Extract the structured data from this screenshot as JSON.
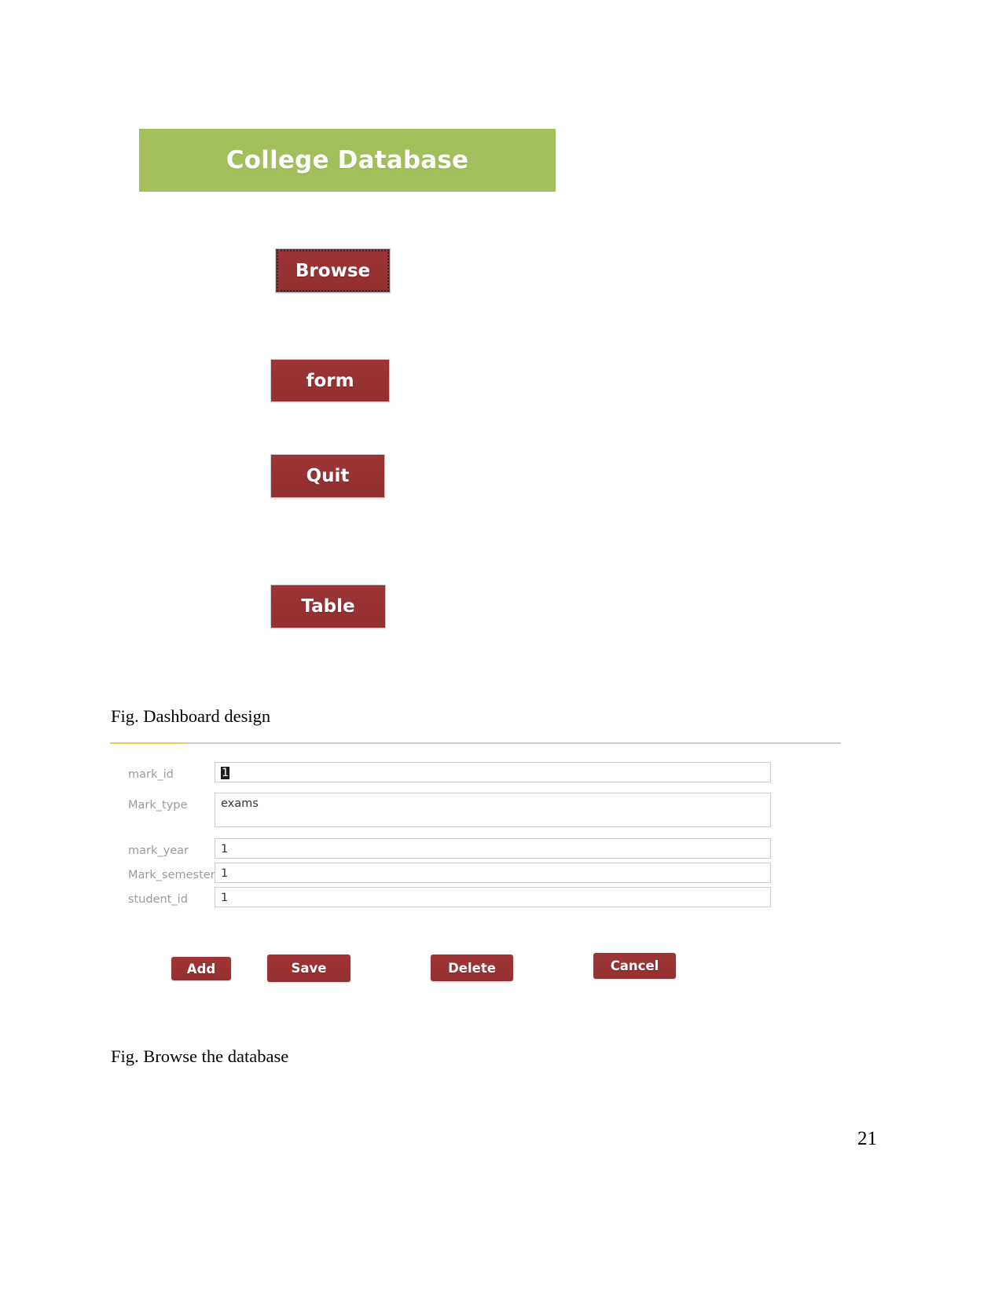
{
  "document": {
    "page_number": "21",
    "captions": {
      "dashboard": "Fig. Dashboard design",
      "browse": "Fig. Browse the database"
    }
  },
  "colors": {
    "header_green": "#a3bf5c",
    "button_red": "#9e3233",
    "accent_yellow": "#e8c95a",
    "field_border": "#c9ccd2",
    "label_gray": "#9a9a9a"
  },
  "dashboard": {
    "header_title": "College Database",
    "buttons": [
      {
        "label": "Browse",
        "focused": true
      },
      {
        "label": "form",
        "focused": false
      },
      {
        "label": "Quit",
        "focused": false
      },
      {
        "label": "Table",
        "focused": false
      }
    ]
  },
  "browse_form": {
    "fields": [
      {
        "label": "mark_id",
        "value": "1",
        "selected": true,
        "multiline": false
      },
      {
        "label": "Mark_type",
        "value": "exams",
        "selected": false,
        "multiline": true
      },
      {
        "label": "mark_year",
        "value": "1",
        "selected": false,
        "multiline": false
      },
      {
        "label": "Mark_semesters",
        "value": "1",
        "selected": false,
        "multiline": false
      },
      {
        "label": "student_id",
        "value": "1",
        "selected": false,
        "multiline": false
      }
    ],
    "actions": [
      {
        "label": "Add"
      },
      {
        "label": "Save"
      },
      {
        "label": "Delete"
      },
      {
        "label": "Cancel"
      }
    ]
  }
}
